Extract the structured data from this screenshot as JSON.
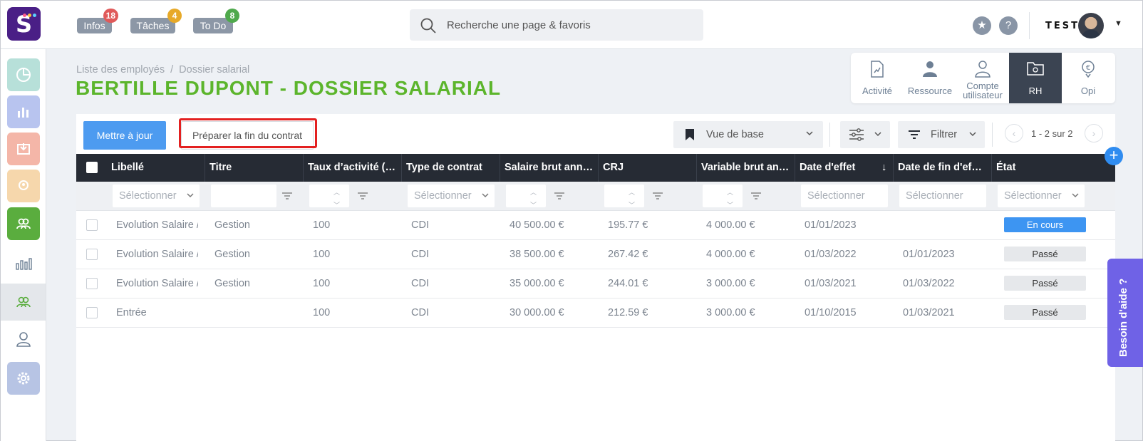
{
  "topbar": {
    "pills": [
      {
        "label": "Infos",
        "count": "18",
        "color": "#e05a5a"
      },
      {
        "label": "Tâches",
        "count": "4",
        "color": "#e7a928"
      },
      {
        "label": "To Do",
        "count": "8",
        "color": "#4fa94c"
      }
    ],
    "search_placeholder": "Recherche une page & favoris",
    "help_label": "?",
    "company_logo": "TEST"
  },
  "breadcrumb": [
    "Liste des employés",
    "Dossier salarial"
  ],
  "breadcrumb_sep": "/",
  "page_title": "BERTILLE DUPONT - DOSSIER SALARIAL",
  "module_tabs": [
    {
      "label": "Activité",
      "icon": "activity-doc-icon"
    },
    {
      "label": "Ressource",
      "icon": "resource-user-icon"
    },
    {
      "label": "Compte utilisateur",
      "icon": "user-account-icon"
    },
    {
      "label": "RH",
      "icon": "hr-folder-icon",
      "active": true
    },
    {
      "label": "Opi",
      "icon": "euro-pin-icon"
    }
  ],
  "toolbar": {
    "update_label": "Mettre à jour",
    "prepare_end_label": "Préparer la fin du contrat",
    "view_label": "Vue de base",
    "filter_label": "Filtrer",
    "pagination": "1 - 2 sur 2"
  },
  "table": {
    "headers": [
      "Libellé",
      "Titre",
      "Taux d’activité (…",
      "Type de contrat",
      "Salaire brut ann…",
      "CRJ",
      "Variable brut an…",
      "Date d'effet",
      "Date de fin d'ef…",
      "État"
    ],
    "sort_indicator": "↓",
    "filter_placeholder": "Sélectionner",
    "rows": [
      {
        "libelle": "Evolution Salaire /",
        "titre": "Gestion",
        "taux": "100",
        "type": "CDI",
        "salaire": "40 500.00 €",
        "crj": "195.77 €",
        "variable": "4 000.00 €",
        "date_effet": "01/01/2023",
        "date_fin": "",
        "etat": "En cours"
      },
      {
        "libelle": "Evolution Salaire /",
        "titre": "Gestion",
        "taux": "100",
        "type": "CDI",
        "salaire": "38 500.00 €",
        "crj": "267.42 €",
        "variable": "4 000.00 €",
        "date_effet": "01/03/2022",
        "date_fin": "01/01/2023",
        "etat": "Passé"
      },
      {
        "libelle": "Evolution Salaire /",
        "titre": "Gestion",
        "taux": "100",
        "type": "CDI",
        "salaire": "35 000.00 €",
        "crj": "244.01 €",
        "variable": "3 000.00 €",
        "date_effet": "01/03/2021",
        "date_fin": "01/03/2022",
        "etat": "Passé"
      },
      {
        "libelle": "Entrée",
        "titre": "",
        "taux": "100",
        "type": "CDI",
        "salaire": "30 000.00 €",
        "crj": "212.59 €",
        "variable": "3 000.00 €",
        "date_effet": "01/10/2015",
        "date_fin": "01/03/2021",
        "etat": "Passé"
      }
    ]
  },
  "help_tab": "Besoin d'aide ?",
  "colors": {
    "accent": "#4d9bf0",
    "title_green": "#5cb52c",
    "brand": "#4a1f86",
    "help": "#6f62e6",
    "highlight": "#e32020"
  }
}
